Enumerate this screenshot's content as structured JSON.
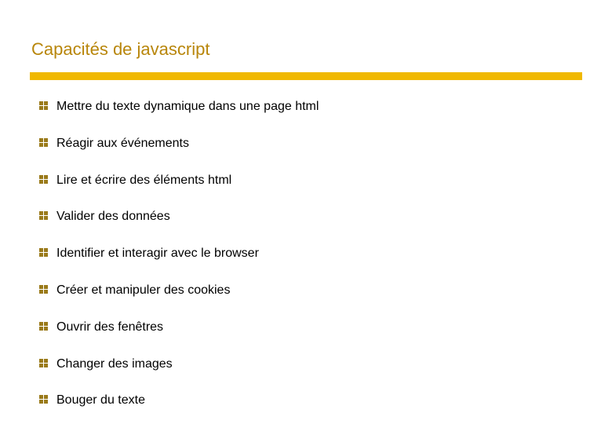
{
  "slide": {
    "title": "Capacités de javascript",
    "bullets": [
      {
        "text": "Mettre du texte dynamique dans une page html"
      },
      {
        "text": "Réagir aux événements"
      },
      {
        "text": "Lire et écrire des éléments html"
      },
      {
        "text": "Valider des données"
      },
      {
        "text": "Identifier et interagir avec le browser"
      },
      {
        "text": "Créer et manipuler des cookies"
      },
      {
        "text": "Ouvrir des fenêtres"
      },
      {
        "text": "Changer des images"
      },
      {
        "text": "Bouger du texte"
      }
    ]
  }
}
